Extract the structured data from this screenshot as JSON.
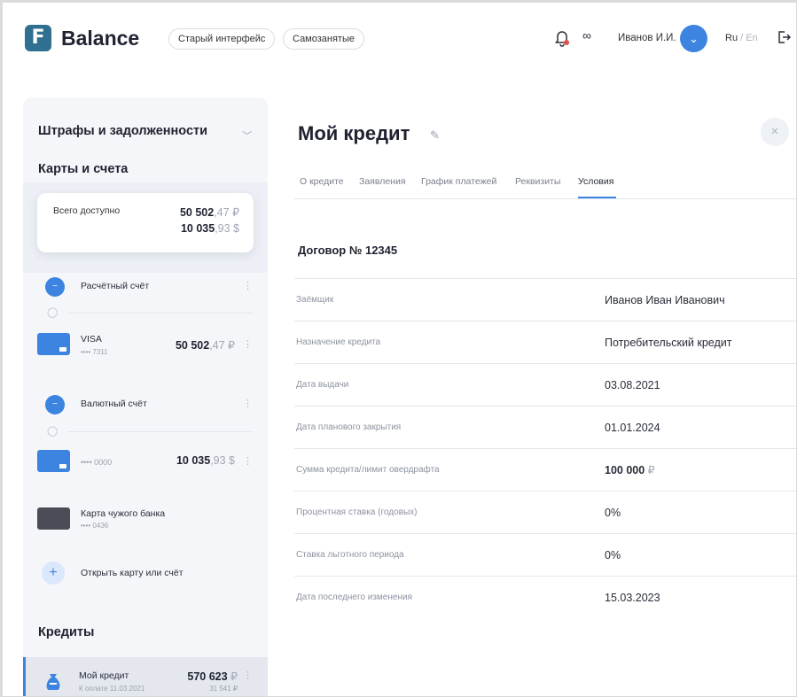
{
  "header": {
    "logo_mark": "F",
    "logo_text": "Balance",
    "old_ui_label": "Старый интерфейс",
    "selfemployed_label": "Самозанятые",
    "link_icon": "∞",
    "user_name": "Иванов И.И.",
    "lang_active": "Ru",
    "lang_sep": " / ",
    "lang_inactive": "En"
  },
  "sidebar": {
    "fines_title": "Штрафы и задолженности",
    "cards_title": "Карты и счета",
    "total": {
      "label": "Всего доступно",
      "rub_int": "50 502",
      "rub_frac": ",47 ₽",
      "usd_int": "10 035",
      "usd_frac": ",93 $"
    },
    "account_rub": {
      "label": "Расчётный счёт"
    },
    "card_visa": {
      "label": "VISA",
      "number": "•••• 7311",
      "amount_int": "50 502",
      "amount_frac": ",47 ₽"
    },
    "account_usd": {
      "label": "Валютный счёт"
    },
    "card_usd": {
      "number": "•••• 0000",
      "amount_int": "10 035",
      "amount_frac": ",93 $"
    },
    "other_bank": {
      "label": "Карта чужого банка",
      "number": "•••• 0436"
    },
    "open_label": "Открыть карту или счёт",
    "credits_title": "Кредиты",
    "credit": {
      "label": "Мой кредит",
      "due": "К оплате 11.03.2021",
      "amount_int": "570 623",
      "amount_cur": " ₽",
      "due_amount": "31 541 ₽"
    }
  },
  "main": {
    "title": "Мой кредит",
    "tabs": [
      {
        "label": "О кредите"
      },
      {
        "label": "Заявления"
      },
      {
        "label": "График платежей"
      },
      {
        "label": "Реквизиты"
      },
      {
        "label": "Условия"
      }
    ],
    "active_tab": "Условия",
    "contract": "Договор № 12345",
    "rows": [
      {
        "label": "Заёмщик",
        "value": "Иванов Иван Иванович"
      },
      {
        "label": "Назначение кредита",
        "value": "Потребительский кредит"
      },
      {
        "label": "Дата выдачи",
        "value": "03.08.2021"
      },
      {
        "label": "Дата планового закрытия",
        "value": "01.01.2024"
      },
      {
        "label": "Сумма кредита/лимит овердрафта",
        "value": "100 000",
        "currency": " ₽"
      },
      {
        "label": "Процентная ставка (годовых)",
        "value": "0%"
      },
      {
        "label": "Ставка льготного периода",
        "value": "0%"
      },
      {
        "label": "Дата последнего изменения",
        "value": "15.03.2023"
      }
    ]
  },
  "colors": {
    "accent": "#3c84e0",
    "logo": "#2f6f8f",
    "notification": "#e05050"
  }
}
